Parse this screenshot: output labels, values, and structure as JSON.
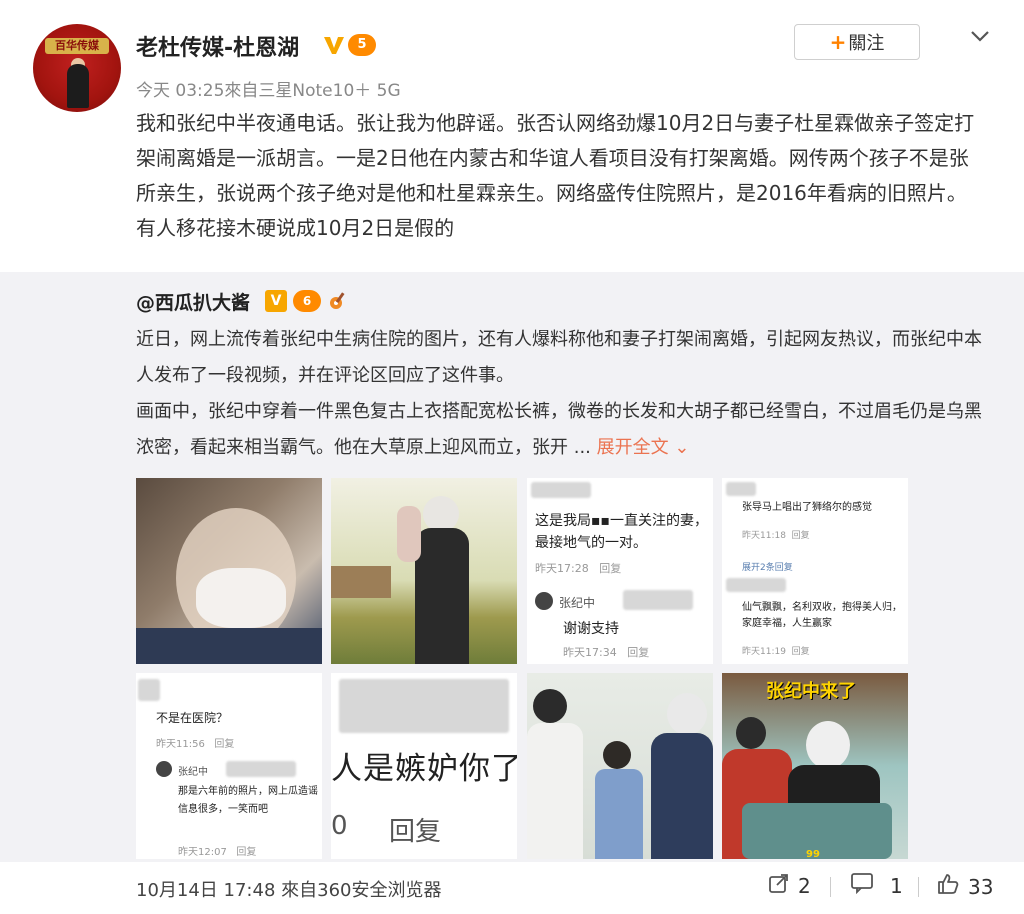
{
  "post": {
    "username": "老杜传媒-杜恩湖",
    "level_badge": "5",
    "follow_label": "關注",
    "meta": "今天 03:25來自三星Note10＋ 5G",
    "text": "我和张纪中半夜通电话。张让我为他辟谣。张否认网络劲爆10月2日与妻子杜星霖做亲子签定打架闹离婚是一派胡言。一是2日他在内蒙古和华谊人看项目没有打架离婚。网传两个孩子不是张所亲生，张说两个孩子绝对是他和杜星霖亲生。网络盛传住院照片，是2016年看病的旧照片。有人移花接木硬说成10月2日是假的"
  },
  "avatar": {
    "banner_text": "百华传媒"
  },
  "repost": {
    "username": "@西瓜扒大酱",
    "level_badge": "6",
    "paragraph1": "近日，网上流传着张纪中生病住院的图片，还有人爆料称他和妻子打架闹离婚，引起网友热议，而张纪中本人发布了一段视频，并在评论区回应了这件事。",
    "paragraph2": "画面中，张纪中穿着一件黑色复古上衣搭配宽松长裤，微卷的长发和大胡子都已经雪白，不过眉毛仍是乌黑浓密，看起来相当霸气。他在大草原上迎风而立，张开 ... ",
    "expand_label": "展开全文"
  },
  "thumbs": {
    "t3": {
      "text": "这是我局▪▪一直关注的妻，最接地气的一对。",
      "meta": "昨天17:28",
      "reply": "回复",
      "name": "张纪中",
      "reply_text": "谢谢支持",
      "meta2": "昨天17:34",
      "reply2": "回复"
    },
    "t4": {
      "name1": "张导马上唱出了狮络尔的感觉",
      "meta1": "昨天11:18",
      "reply1": "回复",
      "sub": "展开2条回复",
      "text2": "仙气飘飘，名利双收，抱得美人归，家庭幸福，人生赢家",
      "meta2": "昨天11:19",
      "reply2": "回复"
    },
    "t5": {
      "text": "不是在医院？",
      "meta": "昨天11:56",
      "reply": "回复",
      "name": "张纪中",
      "reply_text": "那是六年前的照片，网上瓜造谣信息很多，一笑而吧",
      "meta2": "昨天12:07",
      "reply2": "回复"
    },
    "t6": {
      "text": "人是嫉妒你了",
      "reply": "回复",
      "prefix": "0"
    },
    "t8": {
      "caption": "张纪中来了",
      "count": "99"
    }
  },
  "footer": {
    "time": "10月14日 17:48 來自360安全浏览器",
    "repost_count": "2",
    "comment_count": "1",
    "like_count": "33"
  },
  "colors": {
    "accent": "#ff8200",
    "link": "#eb7350",
    "badge_orange": "#ff8a00",
    "verified": "#f7a600"
  }
}
